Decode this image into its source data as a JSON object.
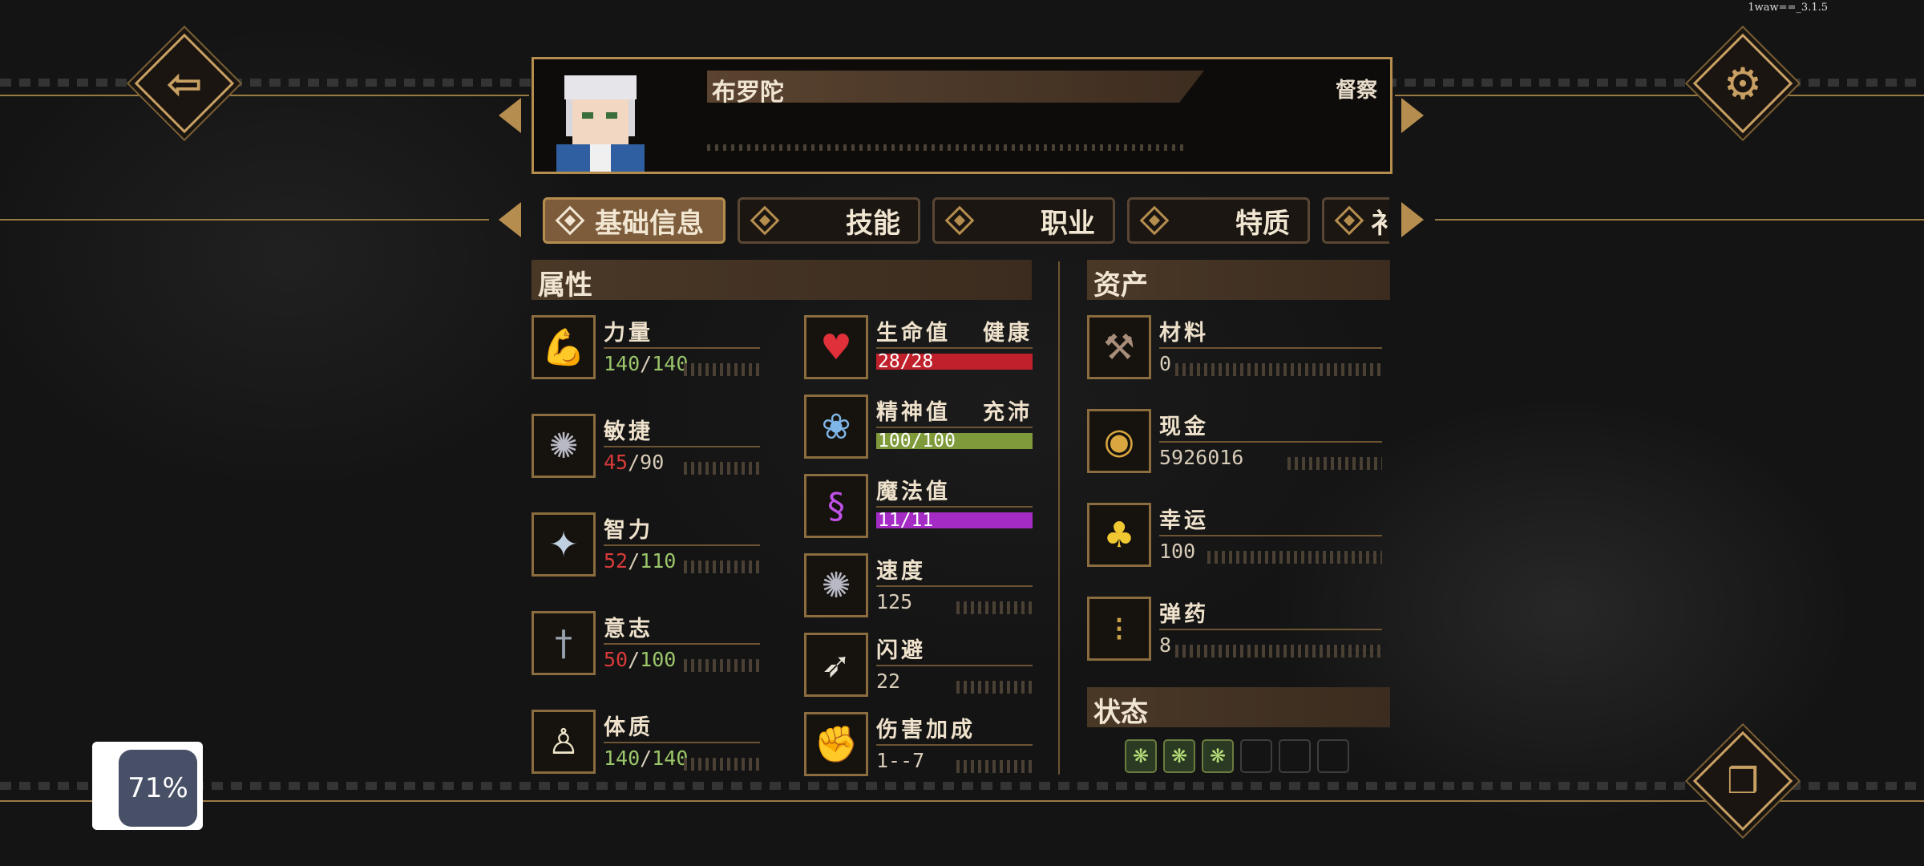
{
  "version": "1waw==_3.1.5",
  "character": {
    "name": "布罗陀",
    "rank": "督察"
  },
  "tabs": [
    {
      "label": "基础信息",
      "active": true
    },
    {
      "label": "技能",
      "active": false
    },
    {
      "label": "职业",
      "active": false
    },
    {
      "label": "特质",
      "active": false
    },
    {
      "label": "衤",
      "active": false
    }
  ],
  "sections": {
    "attributes": "属性",
    "assets": "资产",
    "status": "状态"
  },
  "attributes": [
    {
      "label": "力量",
      "cur": "140",
      "max": "140",
      "cur_color": "#9bc66a",
      "icon": "arm-icon"
    },
    {
      "label": "敏捷",
      "cur": "45",
      "max": "90",
      "cur_color": "#d83a3a",
      "icon": "swirl-icon"
    },
    {
      "label": "智力",
      "cur": "52",
      "max": "110",
      "cur_color": "#d83a3a",
      "icon": "brain-icon"
    },
    {
      "label": "意志",
      "cur": "50",
      "max": "100",
      "cur_color": "#d83a3a",
      "icon": "sword-statue-icon"
    },
    {
      "label": "体质",
      "cur": "140",
      "max": "140",
      "cur_color": "#9bc66a",
      "icon": "torso-icon"
    }
  ],
  "vitals": [
    {
      "label": "生命值",
      "state": "健康",
      "value": "28/28",
      "fill": 1.0,
      "color": "#c0202c",
      "icon": "heart-icon"
    },
    {
      "label": "精神值",
      "state": "充沛",
      "value": "100/100",
      "fill": 1.0,
      "color": "#7f9a3a",
      "icon": "brain-cloud-icon"
    },
    {
      "label": "魔法值",
      "state": "",
      "value": "11/11",
      "fill": 1.0,
      "color": "#a42cc4",
      "icon": "magic-swirl-icon"
    }
  ],
  "combat": [
    {
      "label": "速度",
      "value": "125",
      "icon": "speed-icon"
    },
    {
      "label": "闪避",
      "value": "22",
      "icon": "dodge-icon"
    },
    {
      "label": "伤害加成",
      "value": "1--7",
      "icon": "fist-icon"
    }
  ],
  "assets": [
    {
      "label": "材料",
      "value": "0",
      "icon": "materials-icon"
    },
    {
      "label": "现金",
      "value": "5926016",
      "icon": "coin-icon"
    },
    {
      "label": "幸运",
      "value": "100",
      "icon": "clover-icon"
    },
    {
      "label": "弹药",
      "value": "8",
      "icon": "bullets-icon"
    }
  ],
  "status_effects": {
    "active_count": 3,
    "slot_count": 6
  },
  "overlay": {
    "fps_percent": "71%"
  },
  "colors": {
    "gold": "#b58d4f",
    "bg": "#141414"
  }
}
